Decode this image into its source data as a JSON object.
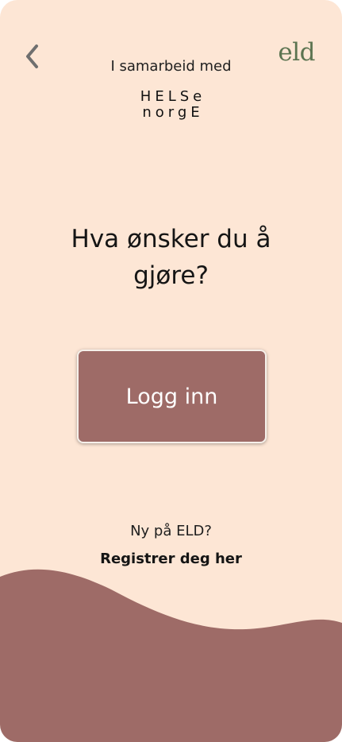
{
  "header": {
    "partner_label": "I samarbeid med",
    "partner_logo_line1": "HELSe",
    "partner_logo_line2": "norgE",
    "brand_logo": "eld"
  },
  "main": {
    "title": "Hva ønsker du å gjøre?",
    "login_label": "Logg inn"
  },
  "footer": {
    "new_user_text": "Ny på ELD?",
    "register_label": "Registrer deg her"
  },
  "colors": {
    "background": "#fde6d5",
    "accent": "#9e6b67",
    "brand": "#5c7451"
  },
  "icons": {
    "back": "chevron-left-icon"
  }
}
